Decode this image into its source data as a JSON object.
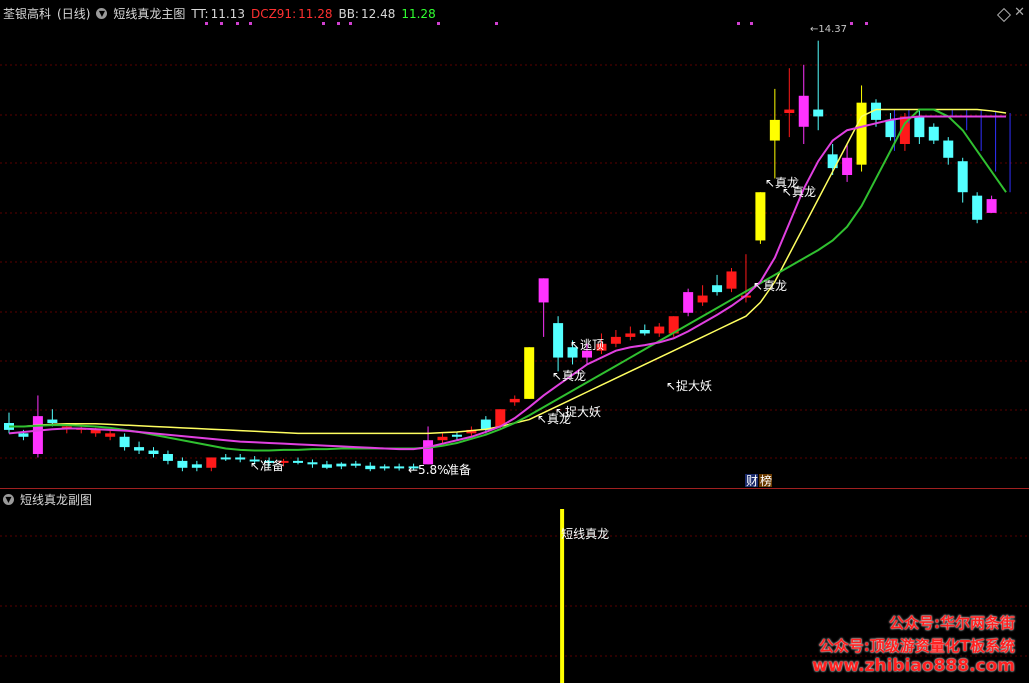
{
  "header": {
    "stock_name": "荃银高科",
    "period": "(日线)",
    "indicator_name": "短线真龙主图",
    "tt_label": "TT:",
    "tt_value": "11.13",
    "dcz_label": "DCZ91:",
    "dcz_value": "11.28",
    "bb_label": "BB:",
    "bb_value": "12.48",
    "last_value": "11.28"
  },
  "sub_panel": {
    "title": "短线真龙副图",
    "signal_label": "短线真龙"
  },
  "annotations": {
    "prepare_1": "准备",
    "prepare_2": "准备",
    "pct": "5.8%",
    "catch_1": "捉大妖",
    "catch_2": "捉大妖",
    "real_dragon_1": "真龙",
    "real_dragon_2": "真龙",
    "real_dragon_3": "真龙",
    "real_dragon_4": "真龙",
    "escape_top": "逃顶",
    "finance_badge": "财",
    "ranking_badge": "榜",
    "peak_label": "14.37"
  },
  "watermark": {
    "line1": "公众号:华尔两条街",
    "line2": "公众号:顶级游资量化T板系统",
    "line3": "www.zhibiao888.com"
  },
  "colors": {
    "bg": "#000000",
    "up_red": "#ff1a1a",
    "down_cyan": "#54ffff",
    "yellow": "#ffff00",
    "magenta": "#ff33ff",
    "line_magenta": "#e040e0",
    "line_yellow": "#ffff60",
    "line_green": "#30c030",
    "grid_red": "#5a0000"
  },
  "chart_data": {
    "type": "candlestick",
    "candles": [
      {
        "o": 10.45,
        "h": 10.6,
        "l": 10.3,
        "c": 10.35,
        "color": "cyan"
      },
      {
        "o": 10.3,
        "h": 10.35,
        "l": 10.2,
        "c": 10.25,
        "color": "cyan"
      },
      {
        "o": 10.0,
        "h": 10.85,
        "l": 9.95,
        "c": 10.55,
        "color": "magenta"
      },
      {
        "o": 10.5,
        "h": 10.65,
        "l": 10.4,
        "c": 10.45,
        "color": "cyan"
      },
      {
        "o": 10.4,
        "h": 10.45,
        "l": 10.3,
        "c": 10.38,
        "color": "red"
      },
      {
        "o": 10.38,
        "h": 10.42,
        "l": 10.3,
        "c": 10.35,
        "color": "red"
      },
      {
        "o": 10.35,
        "h": 10.38,
        "l": 10.25,
        "c": 10.3,
        "color": "red"
      },
      {
        "o": 10.3,
        "h": 10.35,
        "l": 10.2,
        "c": 10.25,
        "color": "red"
      },
      {
        "o": 10.25,
        "h": 10.3,
        "l": 10.05,
        "c": 10.1,
        "color": "cyan"
      },
      {
        "o": 10.1,
        "h": 10.18,
        "l": 10.0,
        "c": 10.05,
        "color": "cyan"
      },
      {
        "o": 10.05,
        "h": 10.1,
        "l": 9.95,
        "c": 10.0,
        "color": "cyan"
      },
      {
        "o": 10.0,
        "h": 10.05,
        "l": 9.85,
        "c": 9.9,
        "color": "cyan"
      },
      {
        "o": 9.9,
        "h": 9.95,
        "l": 9.75,
        "c": 9.8,
        "color": "cyan"
      },
      {
        "o": 9.8,
        "h": 9.9,
        "l": 9.75,
        "c": 9.85,
        "color": "cyan"
      },
      {
        "o": 9.8,
        "h": 9.95,
        "l": 9.75,
        "c": 9.95,
        "color": "red"
      },
      {
        "o": 9.95,
        "h": 10.0,
        "l": 9.9,
        "c": 9.93,
        "color": "cyan"
      },
      {
        "o": 9.95,
        "h": 10.0,
        "l": 9.88,
        "c": 9.92,
        "color": "cyan"
      },
      {
        "o": 9.92,
        "h": 9.97,
        "l": 9.85,
        "c": 9.9,
        "color": "cyan"
      },
      {
        "o": 9.9,
        "h": 9.95,
        "l": 9.82,
        "c": 9.88,
        "color": "cyan"
      },
      {
        "o": 9.88,
        "h": 9.93,
        "l": 9.82,
        "c": 9.9,
        "color": "red"
      },
      {
        "o": 9.9,
        "h": 9.95,
        "l": 9.85,
        "c": 9.88,
        "color": "cyan"
      },
      {
        "o": 9.88,
        "h": 9.92,
        "l": 9.8,
        "c": 9.85,
        "color": "cyan"
      },
      {
        "o": 9.85,
        "h": 9.9,
        "l": 9.78,
        "c": 9.8,
        "color": "cyan"
      },
      {
        "o": 9.82,
        "h": 9.88,
        "l": 9.78,
        "c": 9.86,
        "color": "cyan"
      },
      {
        "o": 9.86,
        "h": 9.9,
        "l": 9.8,
        "c": 9.83,
        "color": "cyan"
      },
      {
        "o": 9.83,
        "h": 9.88,
        "l": 9.75,
        "c": 9.78,
        "color": "cyan"
      },
      {
        "o": 9.8,
        "h": 9.85,
        "l": 9.76,
        "c": 9.82,
        "color": "cyan"
      },
      {
        "o": 9.82,
        "h": 9.86,
        "l": 9.76,
        "c": 9.8,
        "color": "cyan"
      },
      {
        "o": 9.82,
        "h": 9.86,
        "l": 9.76,
        "c": 9.8,
        "color": "cyan"
      },
      {
        "o": 9.85,
        "h": 10.4,
        "l": 9.85,
        "c": 10.2,
        "color": "magenta"
      },
      {
        "o": 10.2,
        "h": 10.3,
        "l": 10.15,
        "c": 10.25,
        "color": "red"
      },
      {
        "o": 10.25,
        "h": 10.32,
        "l": 10.2,
        "c": 10.28,
        "color": "cyan"
      },
      {
        "o": 10.3,
        "h": 10.4,
        "l": 10.25,
        "c": 10.35,
        "color": "red"
      },
      {
        "o": 10.35,
        "h": 10.55,
        "l": 10.3,
        "c": 10.5,
        "color": "cyan"
      },
      {
        "o": 10.4,
        "h": 10.65,
        "l": 10.35,
        "c": 10.65,
        "color": "red"
      },
      {
        "o": 10.8,
        "h": 10.85,
        "l": 10.7,
        "c": 10.75,
        "color": "red"
      },
      {
        "o": 10.8,
        "h": 11.55,
        "l": 10.8,
        "c": 11.55,
        "color": "yellow"
      },
      {
        "o": 12.2,
        "h": 12.55,
        "l": 11.7,
        "c": 12.55,
        "color": "magenta"
      },
      {
        "o": 11.9,
        "h": 12.0,
        "l": 11.2,
        "c": 11.4,
        "color": "cyan"
      },
      {
        "o": 11.55,
        "h": 11.65,
        "l": 11.3,
        "c": 11.4,
        "color": "cyan"
      },
      {
        "o": 11.4,
        "h": 11.6,
        "l": 11.3,
        "c": 11.5,
        "color": "magenta"
      },
      {
        "o": 11.5,
        "h": 11.75,
        "l": 11.45,
        "c": 11.6,
        "color": "red"
      },
      {
        "o": 11.6,
        "h": 11.8,
        "l": 11.55,
        "c": 11.7,
        "color": "red"
      },
      {
        "o": 11.7,
        "h": 11.85,
        "l": 11.65,
        "c": 11.75,
        "color": "red"
      },
      {
        "o": 11.8,
        "h": 11.88,
        "l": 11.72,
        "c": 11.75,
        "color": "cyan"
      },
      {
        "o": 11.75,
        "h": 11.9,
        "l": 11.7,
        "c": 11.85,
        "color": "red"
      },
      {
        "o": 11.75,
        "h": 12.0,
        "l": 11.7,
        "c": 12.0,
        "color": "red"
      },
      {
        "o": 12.05,
        "h": 12.4,
        "l": 12.0,
        "c": 12.35,
        "color": "magenta"
      },
      {
        "o": 12.2,
        "h": 12.45,
        "l": 12.15,
        "c": 12.3,
        "color": "red"
      },
      {
        "o": 12.45,
        "h": 12.6,
        "l": 12.3,
        "c": 12.35,
        "color": "cyan"
      },
      {
        "o": 12.4,
        "h": 12.7,
        "l": 12.35,
        "c": 12.65,
        "color": "red"
      },
      {
        "o": 12.3,
        "h": 12.9,
        "l": 12.2,
        "c": 12.3,
        "color": "red"
      },
      {
        "o": 13.1,
        "h": 13.8,
        "l": 13.05,
        "c": 13.8,
        "color": "yellow"
      },
      {
        "o": 14.55,
        "h": 15.3,
        "l": 14.0,
        "c": 14.85,
        "color": "yellow"
      },
      {
        "o": 14.95,
        "h": 15.6,
        "l": 14.6,
        "c": 15.0,
        "color": "red"
      },
      {
        "o": 15.2,
        "h": 15.65,
        "l": 14.5,
        "c": 14.75,
        "color": "magenta"
      },
      {
        "o": 15.0,
        "h": 16.0,
        "l": 14.7,
        "c": 14.9,
        "color": "cyan"
      },
      {
        "o": 14.35,
        "h": 14.5,
        "l": 14.05,
        "c": 14.15,
        "color": "cyan"
      },
      {
        "o": 14.3,
        "h": 14.5,
        "l": 13.95,
        "c": 14.05,
        "color": "magenta"
      },
      {
        "o": 14.2,
        "h": 15.35,
        "l": 14.1,
        "c": 15.1,
        "color": "yellow"
      },
      {
        "o": 15.1,
        "h": 15.15,
        "l": 14.75,
        "c": 14.85,
        "color": "cyan"
      },
      {
        "o": 14.85,
        "h": 14.95,
        "l": 14.55,
        "c": 14.6,
        "color": "cyan"
      },
      {
        "o": 14.5,
        "h": 14.95,
        "l": 14.4,
        "c": 14.9,
        "color": "red"
      },
      {
        "o": 14.9,
        "h": 15.0,
        "l": 14.5,
        "c": 14.6,
        "color": "cyan"
      },
      {
        "o": 14.75,
        "h": 14.8,
        "l": 14.5,
        "c": 14.55,
        "color": "cyan"
      },
      {
        "o": 14.55,
        "h": 14.6,
        "l": 14.2,
        "c": 14.3,
        "color": "cyan"
      },
      {
        "o": 14.25,
        "h": 14.3,
        "l": 13.65,
        "c": 13.8,
        "color": "cyan"
      },
      {
        "o": 13.75,
        "h": 13.8,
        "l": 13.35,
        "c": 13.4,
        "color": "cyan"
      },
      {
        "o": 13.7,
        "h": 13.75,
        "l": 13.5,
        "c": 13.5,
        "color": "magenta"
      }
    ],
    "line_magenta": [
      10.3,
      10.32,
      10.34,
      10.36,
      10.37,
      10.37,
      10.36,
      10.35,
      10.34,
      10.32,
      10.3,
      10.28,
      10.26,
      10.24,
      10.22,
      10.2,
      10.18,
      10.17,
      10.16,
      10.15,
      10.14,
      10.13,
      10.12,
      10.11,
      10.1,
      10.09,
      10.08,
      10.07,
      10.07,
      10.1,
      10.15,
      10.2,
      10.25,
      10.32,
      10.4,
      10.52,
      10.68,
      10.85,
      11.0,
      11.15,
      11.3,
      11.4,
      11.5,
      11.55,
      11.58,
      11.62,
      11.68,
      11.78,
      11.9,
      12.02,
      12.15,
      12.3,
      12.5,
      12.85,
      13.35,
      13.85,
      14.25,
      14.55,
      14.7,
      14.75,
      14.8,
      14.85,
      14.88,
      14.9,
      14.9,
      14.9,
      14.9,
      14.9,
      14.9,
      14.9
    ],
    "line_yellow": [
      10.4,
      10.4,
      10.42,
      10.43,
      10.44,
      10.44,
      10.44,
      10.43,
      10.42,
      10.41,
      10.4,
      10.39,
      10.38,
      10.37,
      10.36,
      10.35,
      10.34,
      10.33,
      10.32,
      10.31,
      10.3,
      10.3,
      10.3,
      10.3,
      10.3,
      10.3,
      10.3,
      10.3,
      10.3,
      10.3,
      10.31,
      10.32,
      10.34,
      10.36,
      10.4,
      10.45,
      10.5,
      10.6,
      10.7,
      10.8,
      10.9,
      11.0,
      11.1,
      11.2,
      11.3,
      11.4,
      11.5,
      11.6,
      11.7,
      11.8,
      11.9,
      12.0,
      12.2,
      12.5,
      12.9,
      13.3,
      13.7,
      14.1,
      14.5,
      14.9,
      15.0,
      15.0,
      15.0,
      15.0,
      15.0,
      15.0,
      15.0,
      15.0,
      14.98,
      14.95
    ],
    "line_green": [
      10.4,
      10.4,
      10.41,
      10.42,
      10.42,
      10.41,
      10.4,
      10.38,
      10.35,
      10.32,
      10.28,
      10.24,
      10.2,
      10.16,
      10.12,
      10.08,
      10.06,
      10.05,
      10.05,
      10.06,
      10.06,
      10.07,
      10.07,
      10.08,
      10.08,
      10.08,
      10.08,
      10.08,
      10.08,
      10.09,
      10.12,
      10.16,
      10.22,
      10.28,
      10.36,
      10.45,
      10.56,
      10.68,
      10.8,
      10.92,
      11.04,
      11.16,
      11.28,
      11.4,
      11.52,
      11.64,
      11.76,
      11.88,
      12.0,
      12.12,
      12.24,
      12.36,
      12.48,
      12.6,
      12.72,
      12.84,
      12.96,
      13.1,
      13.3,
      13.6,
      14.0,
      14.4,
      14.8,
      15.0,
      15.0,
      14.9,
      14.7,
      14.4,
      14.1,
      13.8
    ],
    "y_range": [
      9.55,
      16.3
    ],
    "sub_signal_index": 38
  }
}
